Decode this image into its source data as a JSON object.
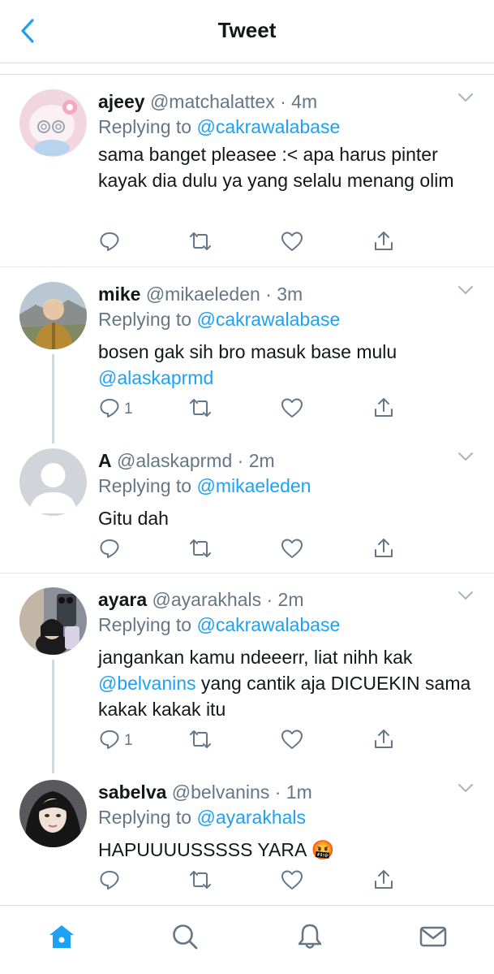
{
  "header": {
    "title": "Tweet",
    "back_icon": "back-chevron-icon"
  },
  "colors": {
    "accent": "#1da1f2",
    "text": "#14171a",
    "muted": "#657786"
  },
  "tweets": [
    {
      "name": "ajeey",
      "handle": "@matchalattex",
      "dot": "·",
      "time": "4m",
      "replying_prefix": "Replying to",
      "replying_to": "@cakrawalabase",
      "text": "sama banget pleasee :< apa harus pinter kayak dia dulu ya yang selalu menang olim",
      "reply_count": ""
    },
    {
      "name": "mike",
      "handle": "@mikaeleden",
      "dot": "·",
      "time": "3m",
      "replying_prefix": "Replying to",
      "replying_to": "@cakrawalabase",
      "text": "bosen gak sih bro masuk base mulu",
      "text_mention": "@alaskaprmd",
      "reply_count": "1"
    },
    {
      "name": "A",
      "handle": "@alaskaprmd",
      "dot": "·",
      "time": "2m",
      "replying_prefix": "Replying to",
      "replying_to": "@mikaeleden",
      "text": "Gitu dah",
      "reply_count": ""
    },
    {
      "name": "ayara",
      "handle": "@ayarakhals",
      "dot": "·",
      "time": "2m",
      "replying_prefix": "Replying to",
      "replying_to": "@cakrawalabase",
      "text_before": "jangankan kamu ndeeerr, liat nihh kak",
      "text_mention": "@belvanins",
      "text_after": " yang cantik aja DICUEKIN sama kakak kakak itu",
      "reply_count": "1"
    },
    {
      "name": "sabelva",
      "handle": "@belvanins",
      "dot": "·",
      "time": "1m",
      "replying_prefix": "Replying to",
      "replying_to": "@ayarakhals",
      "text": "HAPUUUUSSSSS YARA",
      "emoji": "🤬",
      "reply_count": ""
    }
  ],
  "tabbar": {
    "items": [
      "home-icon",
      "search-icon",
      "notifications-bell-icon",
      "messages-mail-icon"
    ],
    "active": "home-icon"
  }
}
